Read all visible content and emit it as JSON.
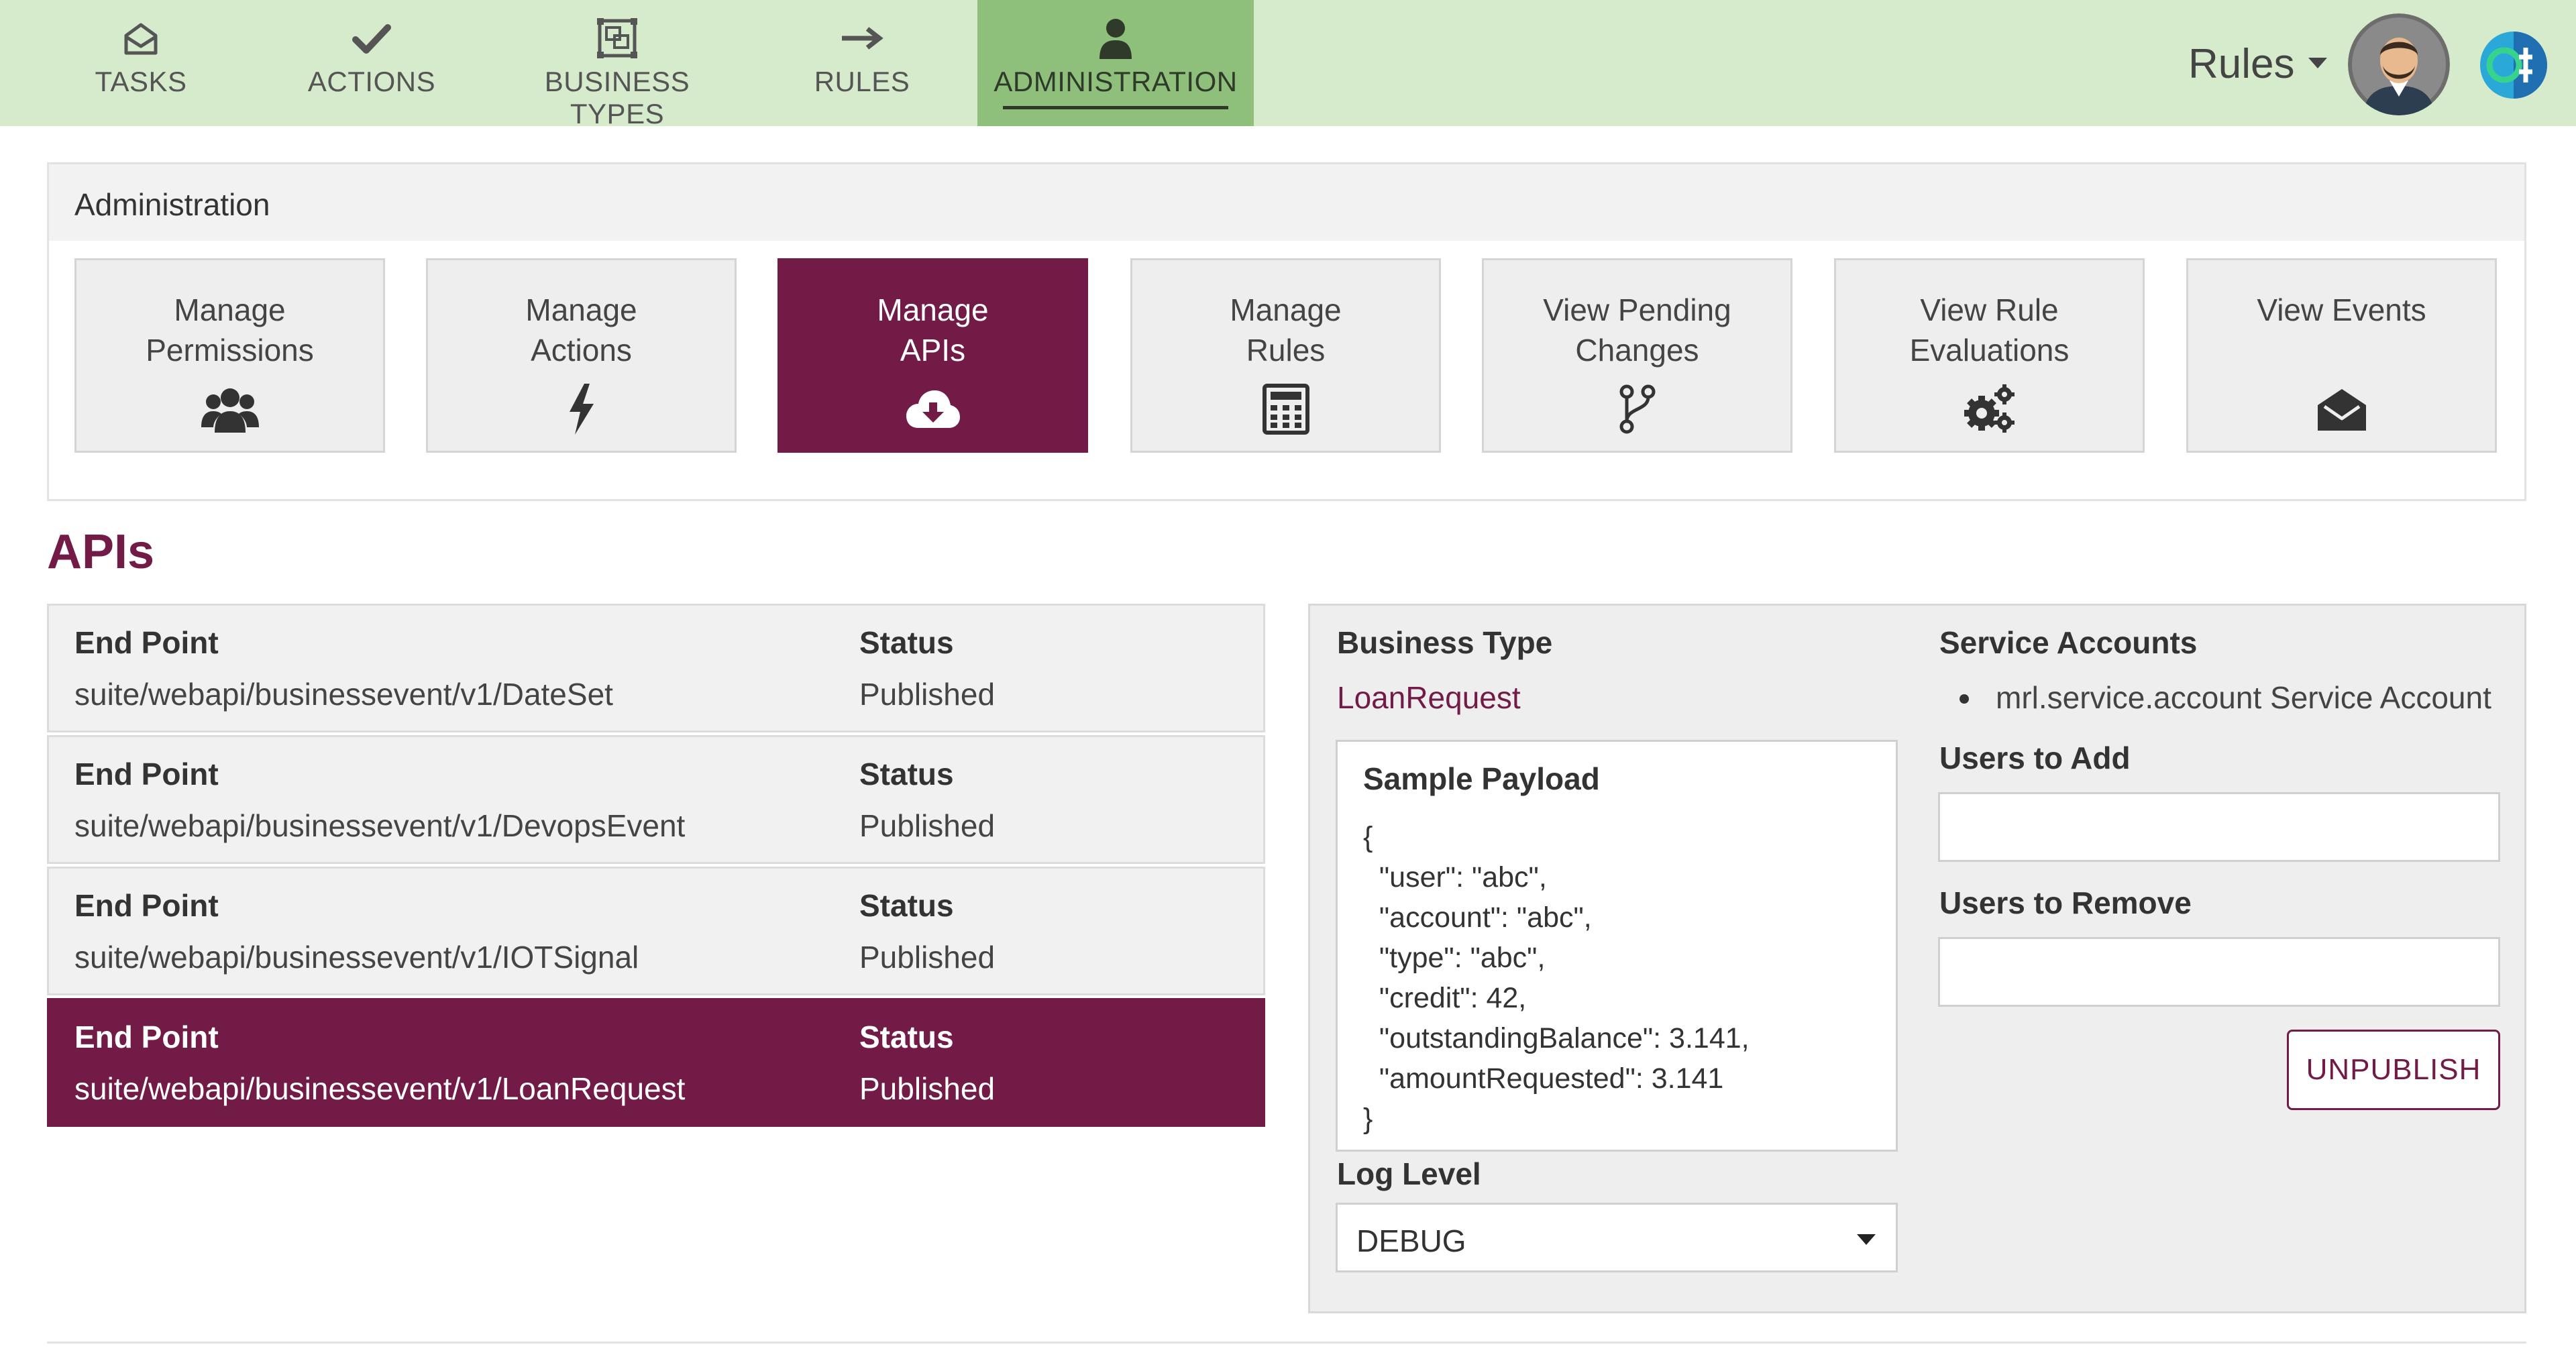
{
  "nav": {
    "items": [
      {
        "label": "TASKS",
        "icon": "envelope-open-icon"
      },
      {
        "label": "ACTIONS",
        "icon": "check-icon"
      },
      {
        "label": "BUSINESS TYPES",
        "icon": "object-group-icon"
      },
      {
        "label": "RULES",
        "icon": "arrow-right-icon"
      },
      {
        "label": "ADMINISTRATION",
        "icon": "user-icon",
        "active": true
      }
    ],
    "app_menu_label": "Rules"
  },
  "colors": {
    "nav_bg": "#d6ebcc",
    "nav_active_bg": "#8ec07c",
    "accent": "#731b47",
    "panel_bg": "#eeeeee"
  },
  "admin": {
    "title": "Administration",
    "tiles": [
      {
        "label": "Manage\nPermissions",
        "icon": "users-icon"
      },
      {
        "label": "Manage\nActions",
        "icon": "bolt-icon"
      },
      {
        "label": "Manage\nAPIs",
        "icon": "cloud-download-icon",
        "active": true
      },
      {
        "label": "Manage\nRules",
        "icon": "calculator-icon"
      },
      {
        "label": "View Pending\nChanges",
        "icon": "code-branch-icon"
      },
      {
        "label": "View Rule\nEvaluations",
        "icon": "cogs-icon"
      },
      {
        "label": "View Events",
        "icon": "envelope-open-icon"
      }
    ]
  },
  "apis": {
    "title": "APIs",
    "endpoint_header": "End Point",
    "status_header": "Status",
    "rows": [
      {
        "endpoint": "suite/webapi/businessevent/v1/DateSet",
        "status": "Published"
      },
      {
        "endpoint": "suite/webapi/businessevent/v1/DevopsEvent",
        "status": "Published"
      },
      {
        "endpoint": "suite/webapi/businessevent/v1/IOTSignal",
        "status": "Published"
      },
      {
        "endpoint": "suite/webapi/businessevent/v1/LoanRequest",
        "status": "Published",
        "selected": true
      }
    ]
  },
  "detail": {
    "business_type_label": "Business Type",
    "business_type_value": "LoanRequest",
    "sample_payload_label": "Sample Payload",
    "sample_payload": "{\n  \"user\": \"abc\",\n  \"account\": \"abc\",\n  \"type\": \"abc\",\n  \"credit\": 42,\n  \"outstandingBalance\": 3.141,\n  \"amountRequested\": 3.141\n}",
    "log_level_label": "Log Level",
    "log_level_value": "DEBUG",
    "service_accounts_label": "Service Accounts",
    "service_accounts": [
      "mrl.service.account Service Account"
    ],
    "users_to_add_label": "Users to Add",
    "users_to_add_value": "",
    "users_to_remove_label": "Users to Remove",
    "users_to_remove_value": "",
    "unpublish_label": "UNPUBLISH"
  }
}
